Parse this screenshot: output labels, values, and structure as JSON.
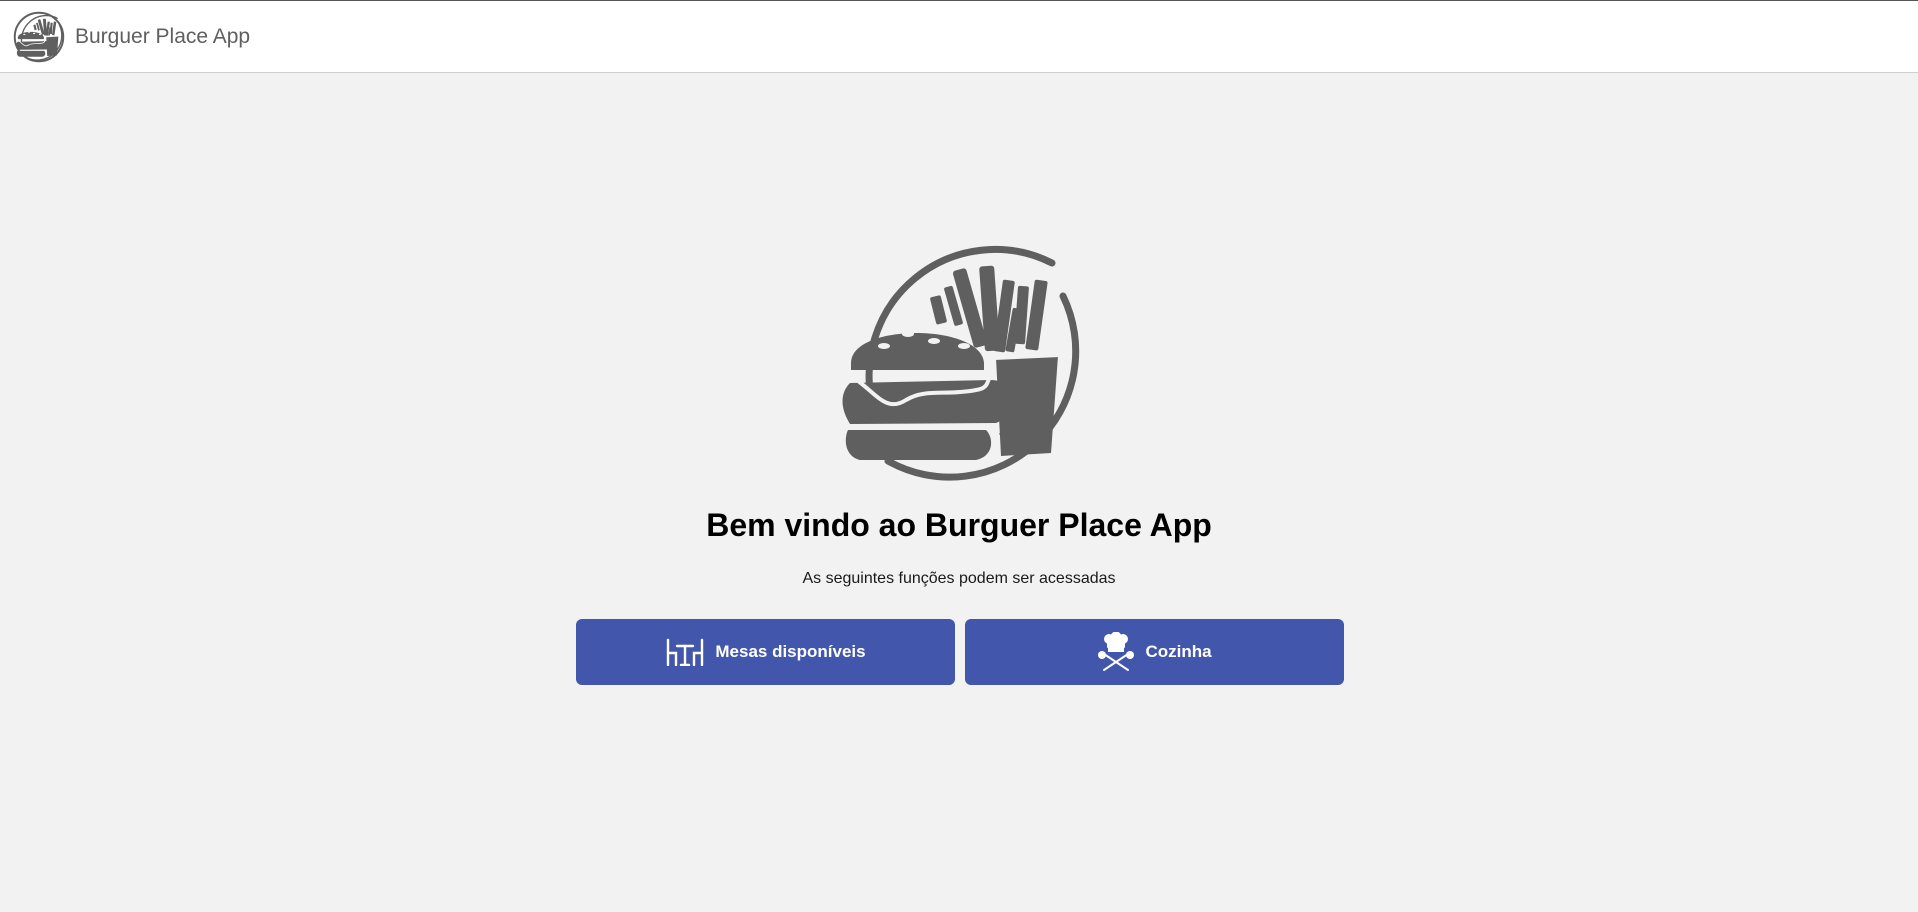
{
  "header": {
    "app_name": "Burguer Place App",
    "logo_icon": "burger-fries-logo-icon"
  },
  "main": {
    "logo_icon": "burger-fries-logo-icon",
    "welcome_title": "Bem vindo ao Burguer Place App",
    "subtitle": "As seguintes funções podem ser acessadas",
    "actions": [
      {
        "label": "Mesas disponíveis",
        "icon": "table-chairs-icon"
      },
      {
        "label": "Cozinha",
        "icon": "chef-hat-utensils-icon"
      }
    ]
  },
  "colors": {
    "primary_button": "#4257ab",
    "background": "#f2f2f2",
    "header_bg": "#ffffff",
    "logo_gray": "#5f5f5f"
  }
}
